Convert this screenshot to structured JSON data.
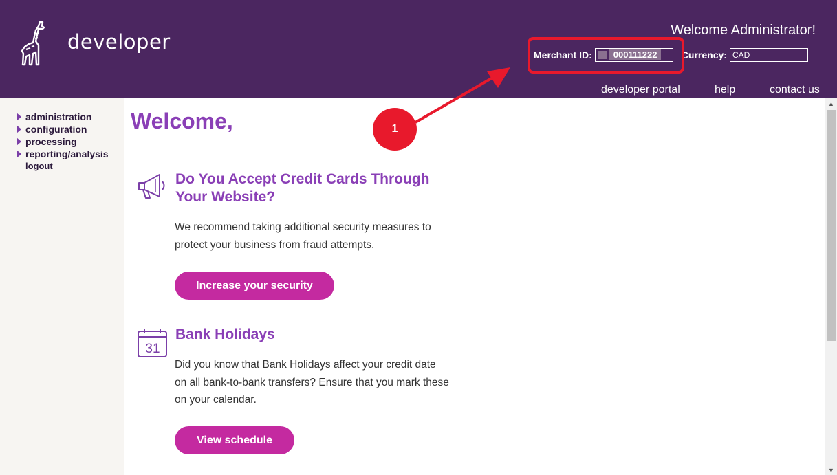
{
  "header": {
    "brand": "developer",
    "welcome": "Welcome Administrator!",
    "merchant_label": "Merchant ID:",
    "merchant_id": "000111222",
    "currency_label": "Currency:",
    "currency": "CAD",
    "nav": [
      "developer portal",
      "help",
      "contact us"
    ]
  },
  "sidebar": {
    "items": [
      "administration",
      "configuration",
      "processing",
      "reporting/analysis"
    ],
    "logout": "logout"
  },
  "main": {
    "title": "Welcome,",
    "cards": [
      {
        "icon": "megaphone-icon",
        "title": "Do You Accept Credit Cards Through Your Website?",
        "text": "We recommend taking additional security measures to protect your business from fraud attempts.",
        "button": "Increase your security"
      },
      {
        "icon": "calendar-icon",
        "icon_number": "31",
        "title": "Bank Holidays",
        "text": "Did you know that Bank Holidays affect your credit date on all bank-to-bank transfers? Ensure that you mark these on your calendar.",
        "button": "View schedule"
      }
    ]
  },
  "annotation": {
    "number": "1",
    "color": "#e8192c"
  },
  "colors": {
    "header_bg": "#4b2660",
    "title_purple": "#8a3fb6",
    "button_magenta": "#c42aa0",
    "sidebar_bg": "#f7f5f2"
  }
}
